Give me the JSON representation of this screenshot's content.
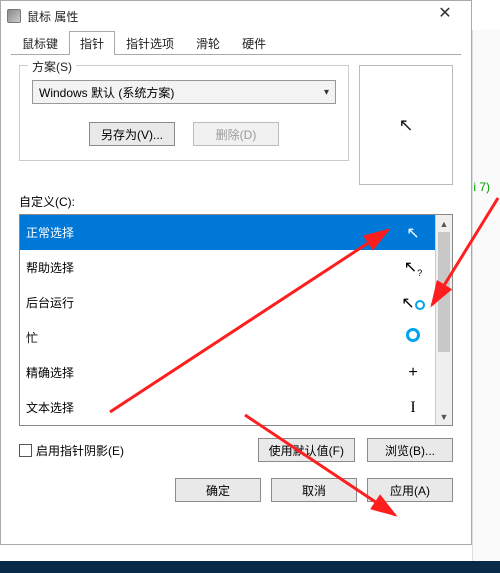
{
  "window": {
    "title": "鼠标 属性",
    "close": "✕"
  },
  "tabs": [
    "鼠标键",
    "指针",
    "指针选项",
    "滑轮",
    "硬件"
  ],
  "activeTab": 1,
  "scheme": {
    "label": "方案(S)",
    "value": "Windows 默认 (系统方案)",
    "saveAs": "另存为(V)...",
    "delete": "删除(D)"
  },
  "customLabel": "自定义(C):",
  "items": [
    {
      "label": "正常选择",
      "icon": "arrow",
      "selected": true
    },
    {
      "label": "帮助选择",
      "icon": "arrow-help"
    },
    {
      "label": "后台运行",
      "icon": "arrow-ring"
    },
    {
      "label": "忙",
      "icon": "ring"
    },
    {
      "label": "精确选择",
      "icon": "cross"
    },
    {
      "label": "文本选择",
      "icon": "ibeam"
    }
  ],
  "shadow": {
    "label": "启用指针阴影(E)"
  },
  "defaultBtn": "使用默认值(F)",
  "browseBtn": "浏览(B)...",
  "ok": "确定",
  "cancel": "取消",
  "apply": "应用(A)",
  "sideLabel": "i 7)"
}
